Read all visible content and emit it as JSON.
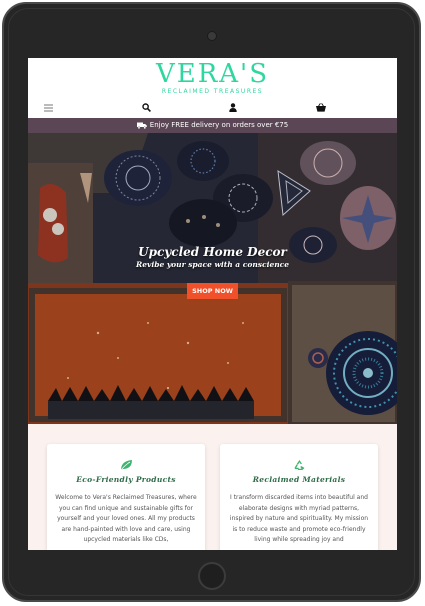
{
  "brand": {
    "name": "VERA'S",
    "tagline": "RECLAIMED TREASURES",
    "color": "#2fd7a0"
  },
  "nav": {
    "icons": [
      "menu-icon",
      "search-icon",
      "account-icon",
      "basket-icon"
    ]
  },
  "delivery": {
    "icon": "truck-icon",
    "text": "Enjoy FREE delivery on orders over €75",
    "bg": "#5a4654"
  },
  "hero": {
    "title": "Upcycled Home Decor",
    "subtitle": "Revibe your space with a conscience",
    "button": "SHOP NOW",
    "button_color": "#f0502a"
  },
  "features": [
    {
      "icon": "leaf-icon",
      "title": "Eco-Friendly Products",
      "text": "Welcome to Vera's Reclaimed Treasures, where you can find unique and sustainable gifts for yourself and your loved ones. All my products are hand-painted with love and care, using upcycled materials like CDs,"
    },
    {
      "icon": "recycle-icon",
      "title": "Reclaimed Materials",
      "text": "I transform discarded items into beautiful and elaborate designs with myriad patterns, inspired by nature and spirituality. My mission is to reduce waste and promote eco-friendly living while spreading joy and"
    }
  ]
}
